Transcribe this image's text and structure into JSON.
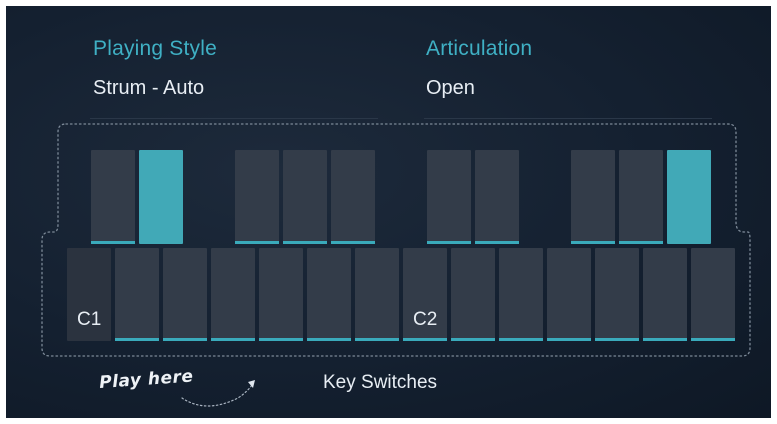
{
  "playing_style": {
    "label": "Playing Style",
    "value": "Strum - Auto"
  },
  "articulation": {
    "label": "Articulation",
    "value": "Open"
  },
  "keyboard": {
    "upper_keys": [
      {
        "id": "u1",
        "active": false
      },
      {
        "id": "u2",
        "active": true
      },
      {
        "id": "u3",
        "active": false
      },
      {
        "id": "u4",
        "active": false
      },
      {
        "id": "u5",
        "active": false
      },
      {
        "id": "u6",
        "active": false
      },
      {
        "id": "u7",
        "active": false
      },
      {
        "id": "u8",
        "active": false
      },
      {
        "id": "u9",
        "active": false
      },
      {
        "id": "u10",
        "active": true
      }
    ],
    "lower_keys": [
      {
        "label": "C1"
      },
      {
        "label": ""
      },
      {
        "label": ""
      },
      {
        "label": ""
      },
      {
        "label": ""
      },
      {
        "label": ""
      },
      {
        "label": ""
      },
      {
        "label": "C2"
      },
      {
        "label": ""
      },
      {
        "label": ""
      },
      {
        "label": ""
      },
      {
        "label": ""
      },
      {
        "label": ""
      },
      {
        "label": ""
      }
    ]
  },
  "hint": {
    "text": "Play here"
  },
  "key_switches_label": "Key Switches",
  "colors": {
    "accent": "#3fb0c4",
    "active_key": "#41a9b7",
    "key": "#333c49",
    "panel_bg": "#142030"
  }
}
